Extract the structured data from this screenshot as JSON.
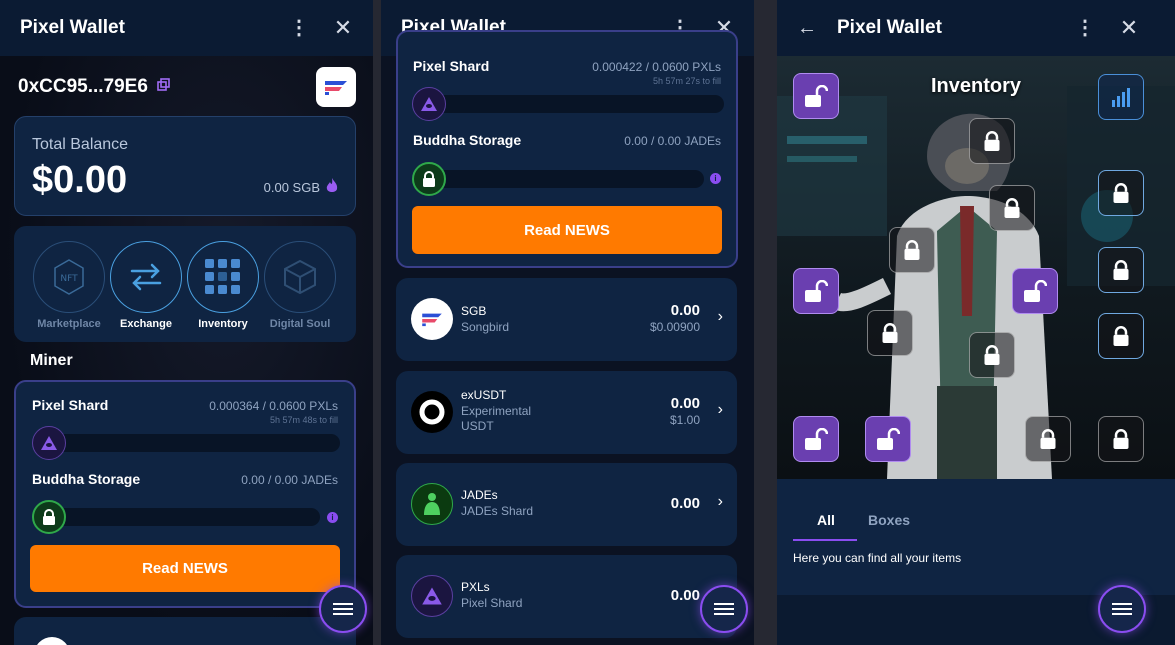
{
  "app_title": "Pixel Wallet",
  "wallet": {
    "address": "0xCC95...79E6",
    "total_balance_label": "Total Balance",
    "total_balance_value": "$0.00",
    "sgb_balance": "0.00 SGB"
  },
  "nav_tiles": [
    {
      "label": "Marketplace",
      "icon": "nft-icon",
      "active": false
    },
    {
      "label": "Exchange",
      "icon": "exchange-arrows-icon",
      "active": true
    },
    {
      "label": "Inventory",
      "icon": "grid-icon",
      "active": true
    },
    {
      "label": "Digital Soul",
      "icon": "cube-icon",
      "active": false
    }
  ],
  "miner": {
    "heading": "Miner",
    "pixel_shard": {
      "name": "Pixel Shard",
      "amount": "0.000364 / 0.0600 PXLs",
      "time": "5h 57m 48s to fill",
      "progress": 0.006
    },
    "buddha_storage": {
      "name": "Buddha Storage",
      "amount": "0.00 / 0.00 JADEs",
      "progress": 0
    },
    "read_news": "Read NEWS"
  },
  "miner2": {
    "pixel_shard": {
      "name": "Pixel Shard",
      "amount": "0.000422 / 0.0600 PXLs",
      "time": "5h 57m 27s to fill",
      "progress": 0.007
    },
    "buddha_storage": {
      "name": "Buddha Storage",
      "amount": "0.00 / 0.00 JADEs",
      "progress": 0
    },
    "read_news": "Read NEWS"
  },
  "assets": [
    {
      "symbol": "SGB",
      "name": "Songbird",
      "amount": "0.00",
      "usd": "$0.00900"
    },
    {
      "symbol": "exUSDT",
      "name_line1": "Experimental",
      "name_line2": "USDT",
      "amount": "0.00",
      "usd": "$1.00"
    },
    {
      "symbol": "JADEs",
      "name": "JADEs Shard",
      "amount": "0.00"
    },
    {
      "symbol": "PXLs",
      "name": "Pixel Shard",
      "amount": "0.00"
    }
  ],
  "inventory": {
    "title": "Inventory",
    "tabs": [
      {
        "label": "All",
        "active": true
      },
      {
        "label": "Boxes",
        "active": false
      }
    ],
    "description": "Here you can find all your items"
  },
  "colors": {
    "accent": "#ff7a00",
    "purple": "#8a4df0",
    "card": "#0f2442",
    "topbar": "#0b1b33"
  }
}
